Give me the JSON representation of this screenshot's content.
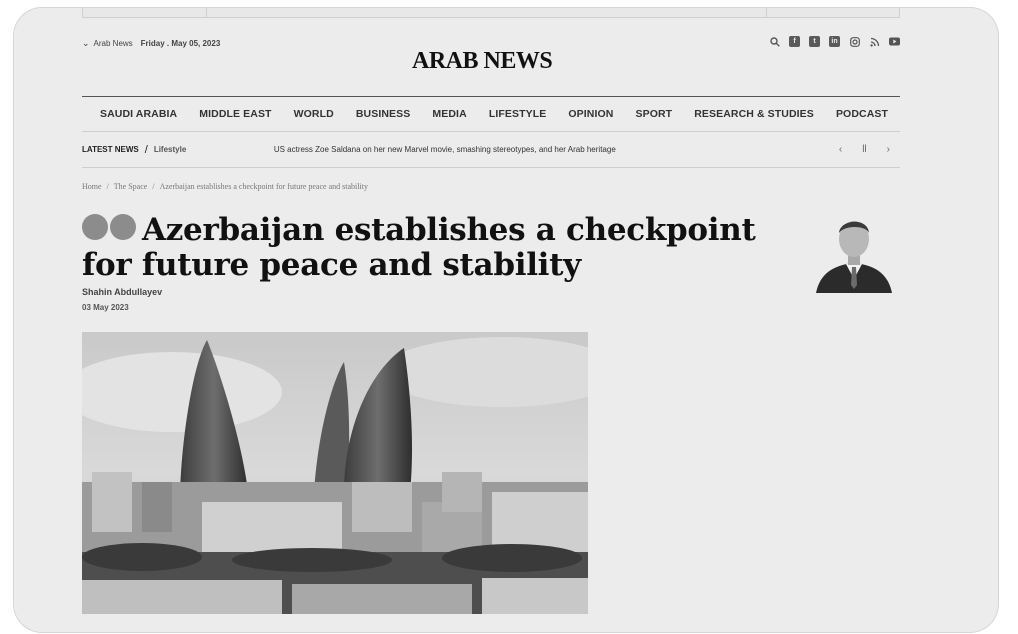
{
  "header": {
    "edition": "Arab News",
    "date": "Friday . May 05, 2023",
    "logo": "ARAB NEWS",
    "social_icons": [
      "search-icon",
      "facebook-icon",
      "twitter-icon",
      "linkedin-icon",
      "instagram-icon",
      "rss-icon",
      "youtube-icon"
    ]
  },
  "nav": {
    "items": [
      "SAUDI ARABIA",
      "MIDDLE EAST",
      "WORLD",
      "BUSINESS",
      "MEDIA",
      "LIFESTYLE",
      "OPINION",
      "SPORT",
      "RESEARCH & STUDIES",
      "PODCAST"
    ]
  },
  "ticker": {
    "label": "LATEST NEWS",
    "category": "Lifestyle",
    "headline": "US actress Zoe Saldana on her new Marvel movie, smashing stereotypes, and her Arab heritage",
    "prev": "‹",
    "pause": "ll",
    "next": "›"
  },
  "breadcrumb": {
    "home": "Home",
    "section": "The Space",
    "current": "Azerbaijan establishes a checkpoint for future peace and stability",
    "sep": "/"
  },
  "article": {
    "title": "Azerbaijan establishes a checkpoint for future peace and stability",
    "author": "Shahin Abdullayev",
    "date": "03 May 2023"
  }
}
